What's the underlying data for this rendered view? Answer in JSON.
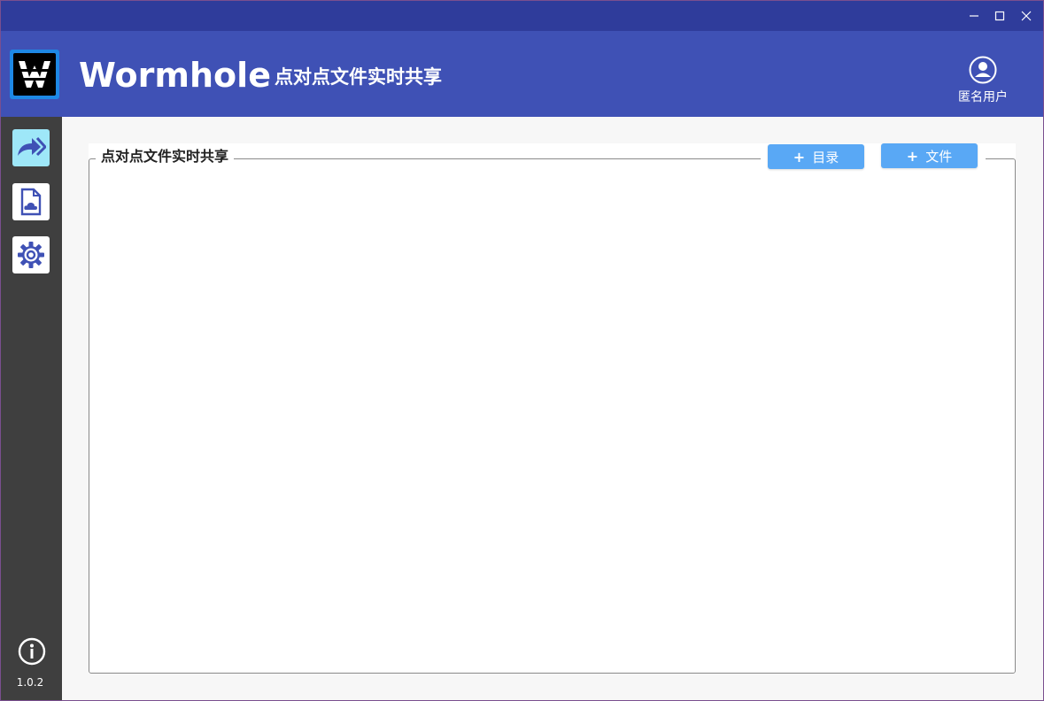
{
  "header": {
    "title": "Wormhole",
    "separator": "-",
    "subtitle": "点对点文件实时共享",
    "user_label": "匿名用户"
  },
  "window_controls": [
    "minimize-icon",
    "maximize-icon",
    "close-icon"
  ],
  "sidebar": {
    "items": [
      {
        "icon": "share-forward-icon",
        "active": true
      },
      {
        "icon": "cloud-file-icon",
        "active": false
      },
      {
        "icon": "gear-icon",
        "active": false
      }
    ],
    "info_icon": "info-icon",
    "version": "1.0.2"
  },
  "main": {
    "panel_title": "点对点文件实时共享",
    "add_dir_plus": "+",
    "add_dir_label": "目录",
    "add_file_plus": "+",
    "add_file_label": "文件"
  },
  "colors": {
    "titlebar": "#2f3c9b",
    "header": "#3f51b5",
    "sidebar": "#3f3f3f",
    "active_item": "#9ee7f8",
    "button": "#59a8f5"
  }
}
